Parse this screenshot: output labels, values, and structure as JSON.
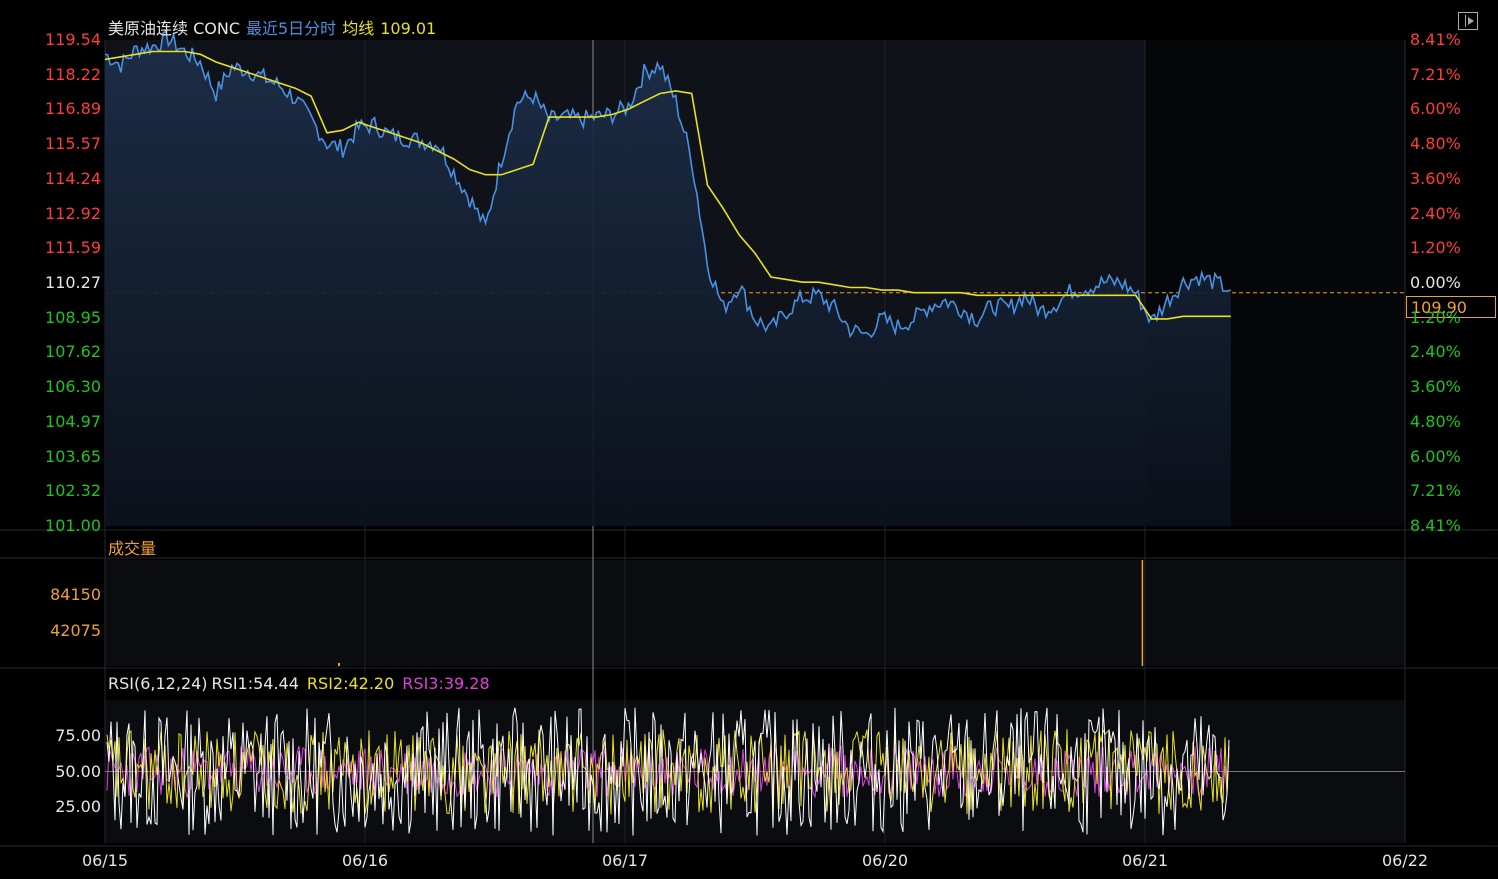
{
  "header": {
    "instrument": "美原油连续 CONC",
    "mode": "最近5日分时",
    "avg_label": "均线",
    "avg_value": "109.01"
  },
  "current_price_tag": "109.90",
  "volume_panel": {
    "label": "成交量"
  },
  "rsi_panel": {
    "params": "RSI(6,12,24)",
    "rsi1": "RSI1:54.44",
    "rsi2": "RSI2:42.20",
    "rsi3": "RSI3:39.28"
  },
  "colors": {
    "price_line": "#4a90e2",
    "avg_line": "#e8e020",
    "up": "#ff3b3b",
    "down": "#1ec51e",
    "volume": "#f0a030",
    "rsi1": "#ffffff",
    "rsi2": "#e8e020",
    "rsi3": "#e040e0"
  },
  "chart_data": [
    {
      "type": "line",
      "title": "美原油连续 CONC 最近5日分时",
      "prev_close": 109.9,
      "y_ticks_left": [
        "119.54",
        "118.22",
        "116.89",
        "115.57",
        "114.24",
        "112.92",
        "111.59",
        "110.27",
        "108.95",
        "107.62",
        "106.30",
        "104.97",
        "103.65",
        "102.32",
        "101.00"
      ],
      "y_ticks_right": [
        "8.41%",
        "7.21%",
        "6.00%",
        "4.80%",
        "3.60%",
        "2.40%",
        "1.20%",
        "0.00%",
        "1.20%",
        "2.40%",
        "3.60%",
        "4.80%",
        "6.00%",
        "7.21%",
        "8.41%"
      ],
      "x_ticks": [
        "06/15",
        "06/16",
        "06/17",
        "06/20",
        "06/21",
        "06/22"
      ],
      "ylim": [
        101.0,
        119.54
      ],
      "x": [
        0,
        0.05,
        0.1,
        0.15,
        0.2,
        0.25,
        0.3,
        0.35,
        0.4,
        0.45,
        0.5,
        0.55,
        0.6,
        0.65,
        0.7,
        0.75,
        0.8,
        0.85,
        0.9,
        0.95,
        1.0,
        1.05,
        1.1,
        1.15,
        1.2,
        1.25,
        1.3,
        1.35,
        1.4,
        1.45,
        1.5,
        1.55,
        1.6,
        1.65,
        1.7,
        1.75,
        1.8,
        1.85,
        1.9,
        1.95,
        2.0,
        2.05,
        2.1,
        2.15,
        2.2,
        2.25,
        2.3,
        2.35,
        2.4,
        2.45,
        2.5,
        2.55,
        2.6,
        2.65,
        2.7,
        2.75,
        2.8,
        2.85,
        2.9,
        2.95,
        3.0,
        3.05,
        3.1,
        3.15,
        3.2,
        3.25,
        3.3,
        3.35,
        3.4,
        3.45,
        3.5,
        3.55,
        3.6,
        3.65,
        3.7,
        3.75,
        3.8,
        3.85,
        3.9,
        3.95,
        4.0,
        4.05,
        4.1,
        4.15,
        4.2,
        4.25,
        4.3,
        4.33
      ],
      "series": [
        {
          "name": "price",
          "values": [
            119.0,
            118.6,
            119.2,
            119.3,
            119.6,
            119.1,
            118.7,
            117.5,
            118.5,
            118.4,
            118.1,
            117.8,
            117.3,
            116.5,
            115.6,
            115.4,
            116.2,
            116.3,
            115.9,
            115.8,
            115.7,
            115.6,
            114.5,
            113.5,
            112.4,
            115.0,
            117.2,
            117.4,
            116.5,
            116.6,
            116.5,
            116.6,
            116.7,
            117.0,
            118.3,
            118.6,
            117.2,
            115.0,
            111.0,
            109.3,
            110.2,
            108.9,
            108.5,
            109.2,
            109.7,
            109.8,
            109.3,
            108.5,
            108.3,
            108.9,
            108.6,
            108.9,
            109.4,
            109.6,
            109.3,
            108.9,
            109.4,
            109.3,
            109.8,
            109.2,
            109.5,
            110.0,
            110.1,
            110.3,
            110.3,
            109.9,
            108.8,
            109.6,
            110.3,
            110.5,
            110.3,
            110.0
          ]
        },
        {
          "name": "avg",
          "values": [
            118.8,
            118.9,
            119.0,
            119.1,
            119.1,
            119.1,
            119.0,
            118.7,
            118.5,
            118.3,
            118.1,
            117.9,
            117.7,
            117.4,
            116.0,
            116.1,
            116.4,
            116.2,
            116.0,
            115.8,
            115.6,
            115.3,
            115.0,
            114.6,
            114.4,
            114.4,
            114.6,
            114.8,
            116.6,
            116.6,
            116.6,
            116.6,
            116.7,
            116.9,
            117.2,
            117.5,
            117.6,
            117.5,
            114.0,
            113.1,
            112.1,
            111.4,
            110.5,
            110.4,
            110.3,
            110.3,
            110.2,
            110.1,
            110.1,
            110.0,
            110.0,
            109.9,
            109.9,
            109.9,
            109.9,
            109.8,
            109.8,
            109.8,
            109.8,
            109.8,
            109.8,
            109.8,
            109.8,
            109.8,
            109.8,
            109.8,
            108.9,
            108.9,
            109.0,
            109.0,
            109.0,
            109.0
          ]
        }
      ]
    },
    {
      "type": "bar",
      "title": "成交量",
      "y_ticks": [
        "84150",
        "42075"
      ],
      "ylim": [
        0,
        126225
      ],
      "x": [
        3.99
      ],
      "values": [
        126225
      ]
    },
    {
      "type": "line",
      "title": "RSI(6,12,24)",
      "y_ticks": [
        "75.00",
        "50.00",
        "25.00"
      ],
      "ylim": [
        0,
        100
      ],
      "series": [
        {
          "name": "RSI1",
          "last": 54.44
        },
        {
          "name": "RSI2",
          "last": 42.2
        },
        {
          "name": "RSI3",
          "last": 39.28
        }
      ]
    }
  ]
}
